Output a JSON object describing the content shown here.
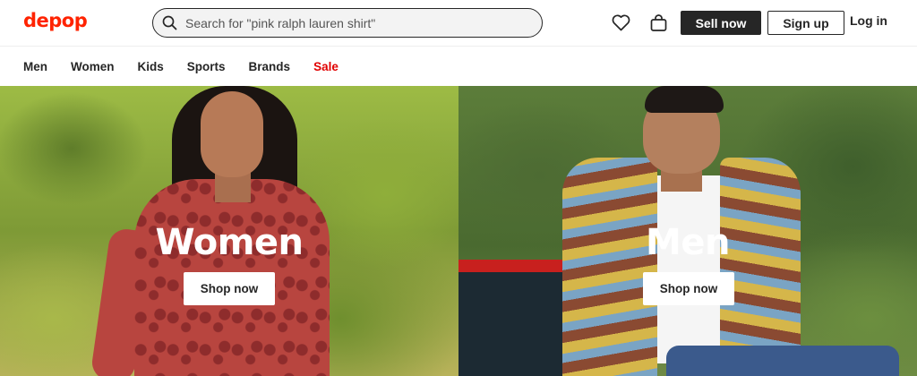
{
  "header": {
    "logo": "depop",
    "search_placeholder": "Search for \"pink ralph lauren shirt\"",
    "sell_label": "Sell now",
    "signup_label": "Sign up",
    "login_label": "Log in",
    "icons": [
      "search-icon",
      "heart-icon",
      "bag-icon"
    ]
  },
  "nav": {
    "items": [
      {
        "label": "Men"
      },
      {
        "label": "Women"
      },
      {
        "label": "Kids"
      },
      {
        "label": "Sports"
      },
      {
        "label": "Brands"
      },
      {
        "label": "Sale"
      }
    ]
  },
  "hero": {
    "women": {
      "title": "Women",
      "button": "Shop now"
    },
    "men": {
      "title": "Men",
      "button": "Shop now"
    }
  },
  "colors": {
    "brand": "#ff2300",
    "sale": "#e10000",
    "text": "#262626"
  }
}
